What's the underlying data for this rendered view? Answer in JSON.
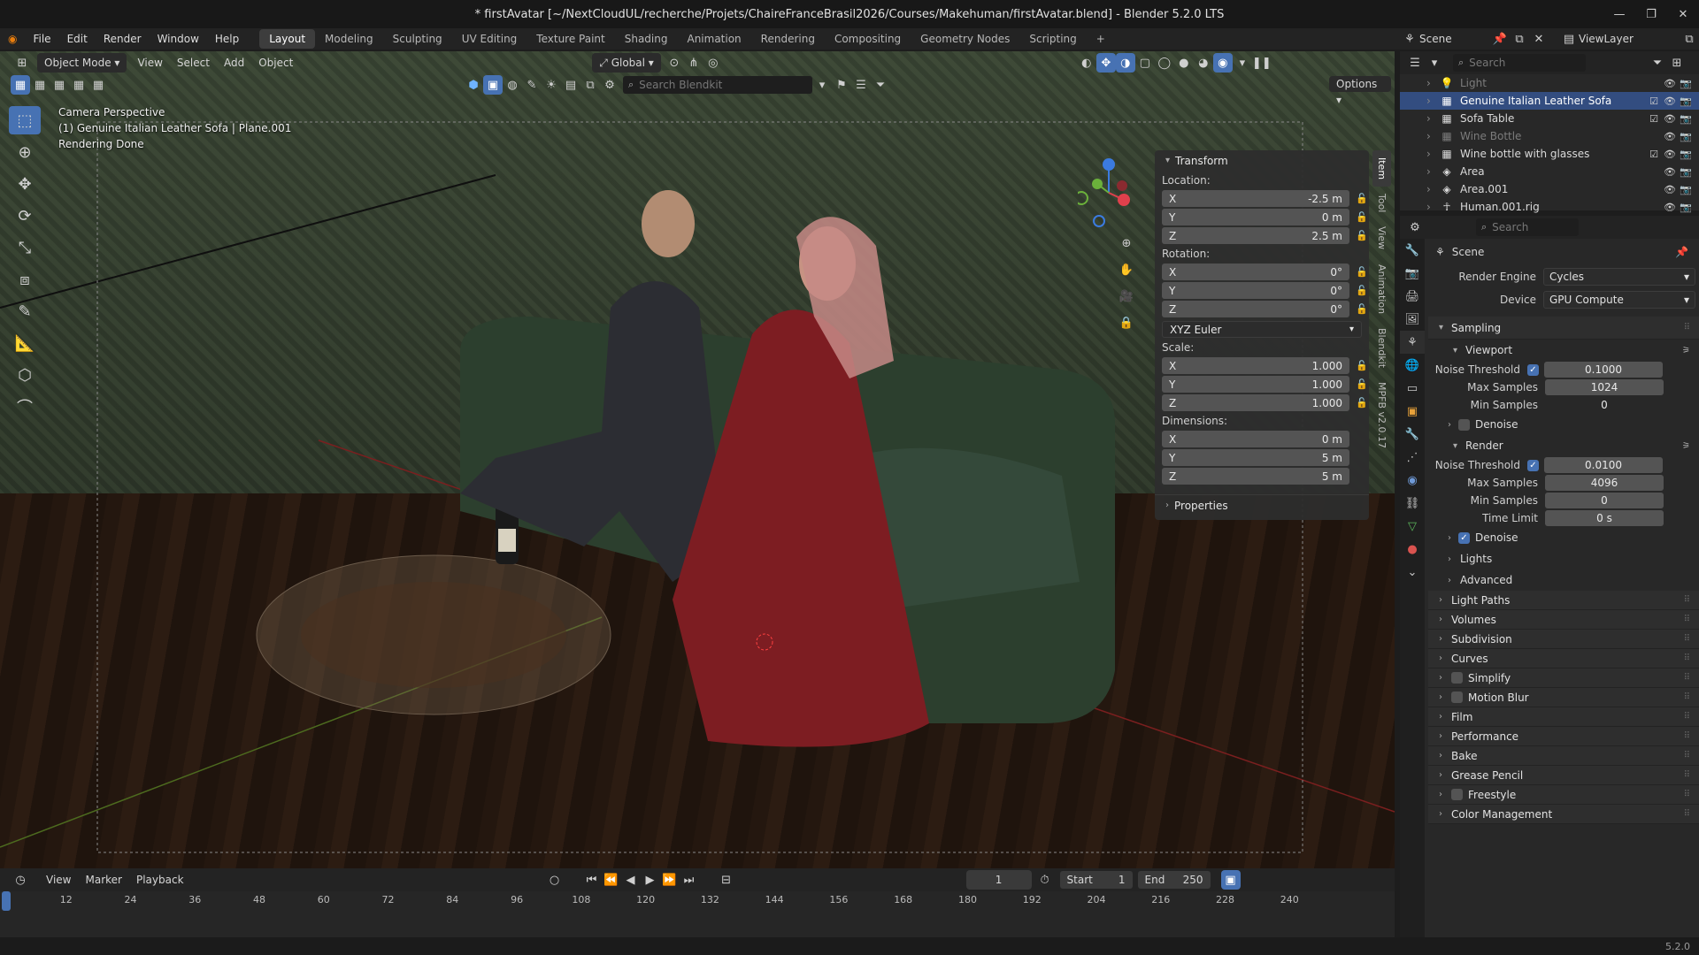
{
  "title": "* firstAvatar [~/NextCloudUL/recherche/Projets/ChaireFranceBrasil2026/Courses/Makehuman/firstAvatar.blend] - Blender 5.2.0 LTS",
  "menu": [
    "File",
    "Edit",
    "Render",
    "Window",
    "Help"
  ],
  "workspaces": [
    "Layout",
    "Modeling",
    "Sculpting",
    "UV Editing",
    "Texture Paint",
    "Shading",
    "Animation",
    "Rendering",
    "Compositing",
    "Geometry Nodes",
    "Scripting"
  ],
  "active_workspace": "Layout",
  "viewport": {
    "mode": "Object Mode",
    "menus": [
      "View",
      "Select",
      "Add",
      "Object"
    ],
    "orientation": "Global",
    "search_placeholder": "Search Blendkit",
    "options_label": "Options",
    "overlay_lines": [
      "Camera Perspective",
      "(1) Genuine Italian Leather Sofa | Plane.001",
      "Rendering Done"
    ]
  },
  "npanel": {
    "transform_label": "Transform",
    "location_label": "Location:",
    "location": [
      {
        "k": "X",
        "v": "-2.5 m"
      },
      {
        "k": "Y",
        "v": "0 m"
      },
      {
        "k": "Z",
        "v": "2.5 m"
      }
    ],
    "rotation_label": "Rotation:",
    "rotation": [
      {
        "k": "X",
        "v": "0°"
      },
      {
        "k": "Y",
        "v": "0°"
      },
      {
        "k": "Z",
        "v": "0°"
      }
    ],
    "rotation_mode": "XYZ Euler",
    "scale_label": "Scale:",
    "scale": [
      {
        "k": "X",
        "v": "1.000"
      },
      {
        "k": "Y",
        "v": "1.000"
      },
      {
        "k": "Z",
        "v": "1.000"
      }
    ],
    "dimensions_label": "Dimensions:",
    "dimensions": [
      {
        "k": "X",
        "v": "0 m"
      },
      {
        "k": "Y",
        "v": "5 m"
      },
      {
        "k": "Z",
        "v": "5 m"
      }
    ],
    "properties_label": "Properties",
    "tabs": [
      "Item",
      "Tool",
      "View",
      "Animation",
      "Blendkit",
      "MPFB v2.0.17"
    ]
  },
  "outliner": {
    "scene_label": "Scene",
    "viewlayer_label": "ViewLayer",
    "search_placeholder": "Search",
    "rows": [
      {
        "name": "Light",
        "state": "dim"
      },
      {
        "name": "Genuine Italian Leather Sofa",
        "state": "selected"
      },
      {
        "name": "Sofa Table",
        "state": "normal"
      },
      {
        "name": "Wine Bottle",
        "state": "dim"
      },
      {
        "name": "Wine bottle with glasses",
        "state": "normal"
      },
      {
        "name": "Area",
        "state": "normal"
      },
      {
        "name": "Area.001",
        "state": "normal"
      },
      {
        "name": "Human.001.rig",
        "state": "normal"
      }
    ]
  },
  "properties": {
    "search_placeholder": "Search",
    "context": "Scene",
    "render_engine_label": "Render Engine",
    "render_engine": "Cycles",
    "device_label": "Device",
    "device": "GPU Compute",
    "sampling": "Sampling",
    "viewport_sub": "Viewport",
    "vp_noise_label": "Noise Threshold",
    "vp_noise": "0.1000",
    "vp_max_label": "Max Samples",
    "vp_max": "1024",
    "vp_min_label": "Min Samples",
    "vp_min": "0",
    "denoise": "Denoise",
    "render_sub": "Render",
    "r_noise_label": "Noise Threshold",
    "r_noise": "0.0100",
    "r_max_label": "Max Samples",
    "r_max": "4096",
    "r_min_label": "Min Samples",
    "r_min": "0",
    "time_limit_label": "Time Limit",
    "time_limit": "0 s",
    "lights": "Lights",
    "advanced": "Advanced",
    "sections": [
      "Light Paths",
      "Volumes",
      "Subdivision",
      "Curves",
      "Simplify",
      "Motion Blur",
      "Film",
      "Performance",
      "Bake",
      "Grease Pencil",
      "Freestyle",
      "Color Management"
    ]
  },
  "timeline": {
    "menus": [
      "View",
      "Marker",
      "Playback"
    ],
    "current_frame": "1",
    "start_label": "Start",
    "start": "1",
    "end_label": "End",
    "end": "250",
    "ticks": [
      "12",
      "24",
      "36",
      "48",
      "60",
      "72",
      "84",
      "96",
      "108",
      "120",
      "132",
      "144",
      "156",
      "168",
      "180",
      "192",
      "204",
      "216",
      "228",
      "240"
    ]
  },
  "status": {
    "version": "5.2.0"
  },
  "colors": {
    "accent": "#4772b3",
    "selected_row": "#334d80"
  }
}
